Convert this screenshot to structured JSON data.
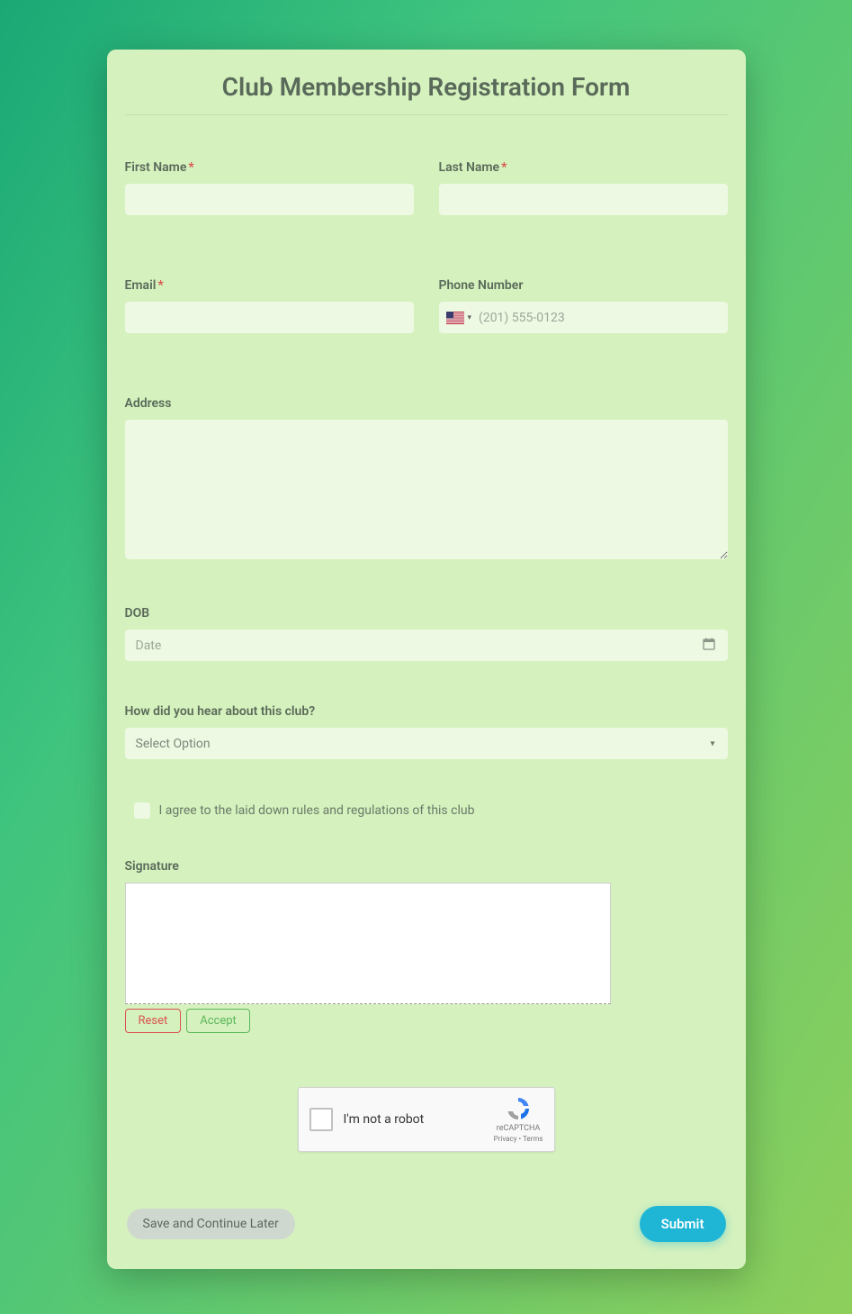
{
  "title": "Club Membership Registration Form",
  "fields": {
    "first_name": {
      "label": "First Name",
      "required": true,
      "value": ""
    },
    "last_name": {
      "label": "Last Name",
      "required": true,
      "value": ""
    },
    "email": {
      "label": "Email",
      "required": true,
      "value": ""
    },
    "phone": {
      "label": "Phone Number",
      "placeholder": "(201) 555-0123",
      "country": "US",
      "value": ""
    },
    "address": {
      "label": "Address",
      "value": ""
    },
    "dob": {
      "label": "DOB",
      "placeholder": "Date",
      "value": ""
    },
    "hear": {
      "label": "How did you hear about this club?",
      "placeholder": "Select Option",
      "value": ""
    },
    "agree": {
      "label": "I agree to the laid down rules and regulations of this club",
      "checked": false
    },
    "signature": {
      "label": "Signature"
    }
  },
  "signature_actions": {
    "reset": "Reset",
    "accept": "Accept"
  },
  "captcha": {
    "text": "I'm not a robot",
    "brand": "reCAPTCHA",
    "links": "Privacy • Terms"
  },
  "footer": {
    "save": "Save and Continue Later",
    "submit": "Submit"
  },
  "required_marker": "*"
}
